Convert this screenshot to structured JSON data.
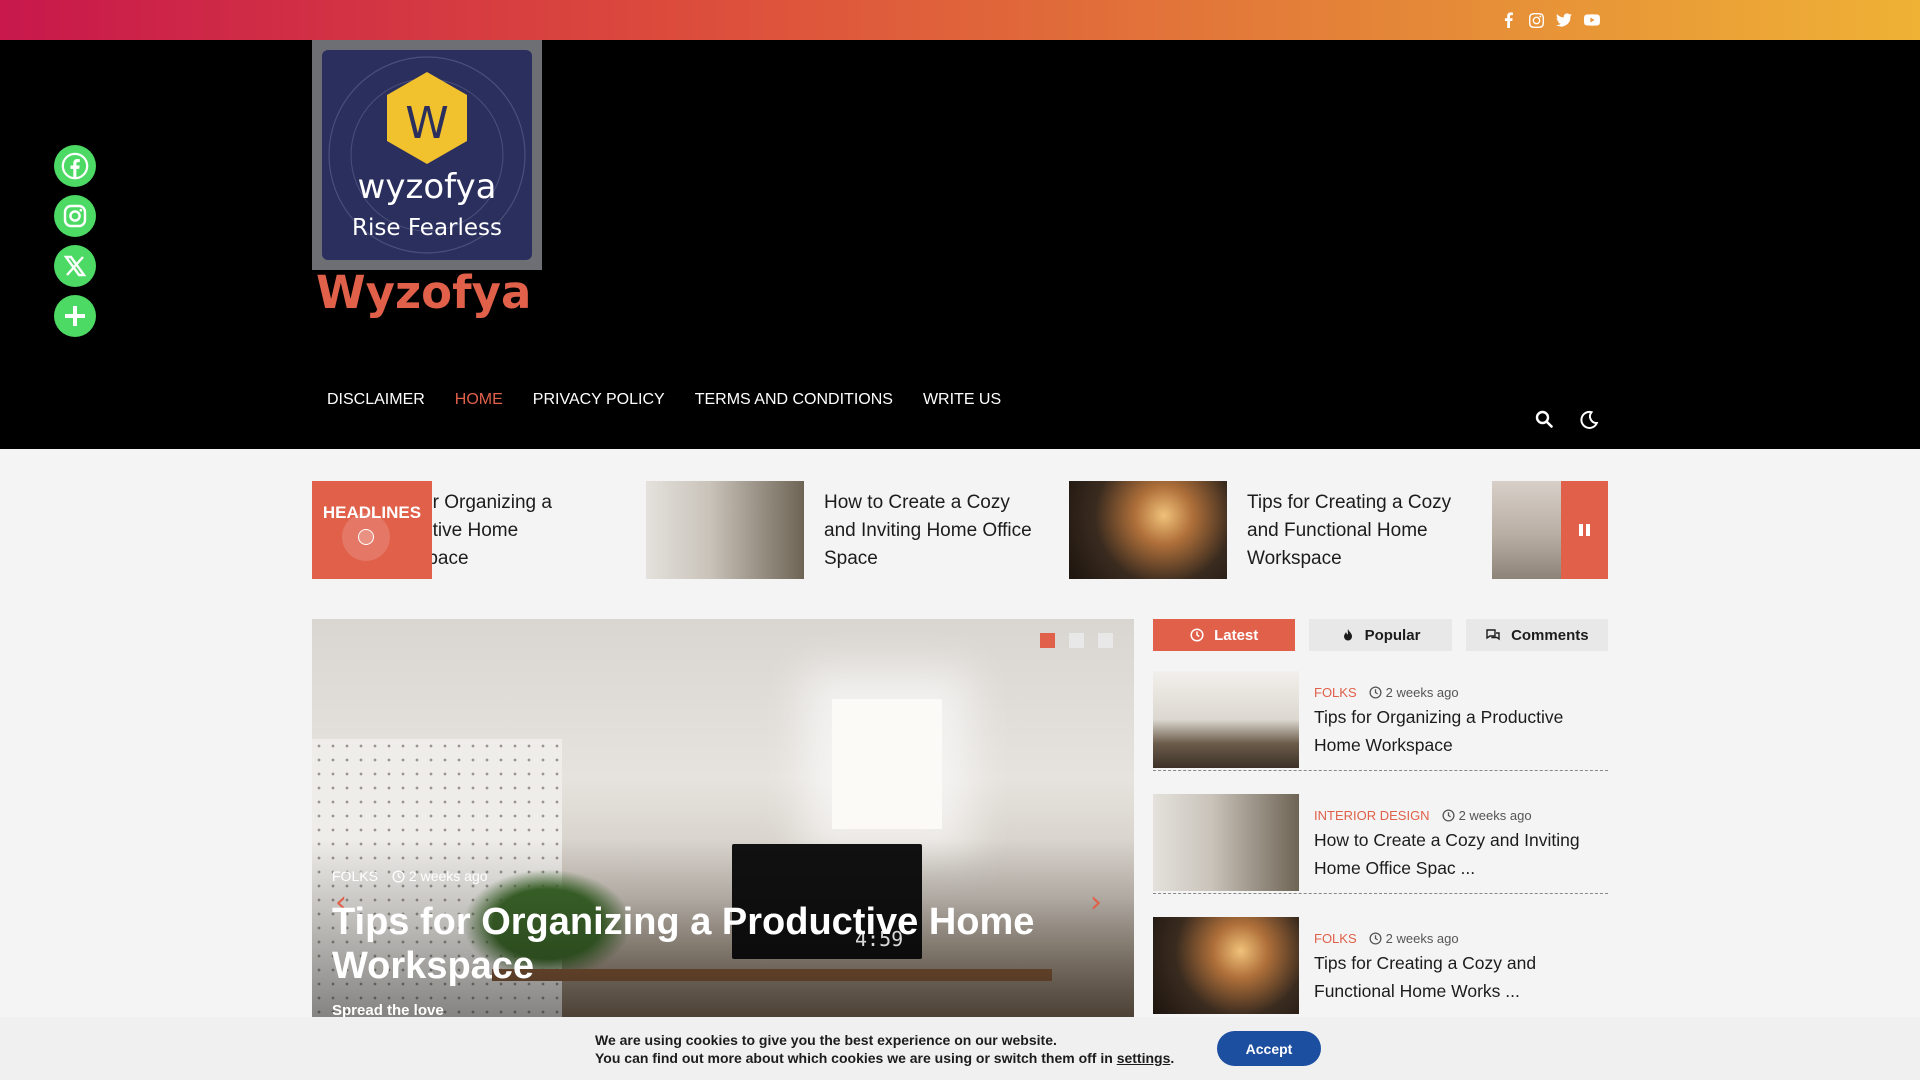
{
  "topbar": {
    "social": [
      "facebook-icon",
      "instagram-icon",
      "twitter-icon",
      "youtube-icon"
    ]
  },
  "logo": {
    "brand": "wyzofya",
    "tagline": "Rise Fearless",
    "letter": "W"
  },
  "site_title": "Wyzofya",
  "nav": {
    "items": [
      {
        "label": "DISCLAIMER",
        "active": false
      },
      {
        "label": "HOME",
        "active": true
      },
      {
        "label": "PRIVACY POLICY",
        "active": false
      },
      {
        "label": "TERMS AND CONDITIONS",
        "active": false
      },
      {
        "label": "WRITE US",
        "active": false
      }
    ]
  },
  "ticker": {
    "label": "HEADLINES",
    "items": [
      {
        "title": "s for Organizing a\nductive Home\nrkspace"
      },
      {
        "title": "How to Create a Cozy and Inviting Home Office Space"
      },
      {
        "title": "Tips for Creating a Cozy and Functional Home Workspace"
      }
    ]
  },
  "slider": {
    "category": "FOLKS",
    "time": "2 weeks ago",
    "title": "Tips for Organizing a Productive Home Workspace",
    "excerpt": "Spread the love",
    "clock": "4:59"
  },
  "tabs": [
    {
      "label": "Latest",
      "active": true
    },
    {
      "label": "Popular",
      "active": false
    },
    {
      "label": "Comments",
      "active": false
    }
  ],
  "posts": [
    {
      "category": "FOLKS",
      "time": "2 weeks ago",
      "title": "Tips for Organizing a Productive Home Workspace"
    },
    {
      "category": "INTERIOR DESIGN",
      "time": "2 weeks ago",
      "title": "How to Create a Cozy and Inviting Home Office Spac ..."
    },
    {
      "category": "FOLKS",
      "time": "2 weeks ago",
      "title": "Tips for Creating a Cozy and Functional Home Works ..."
    }
  ],
  "cookie": {
    "line1": "We are using cookies to give you the best experience on our website.",
    "line2": "You can find out more about which cookies we are using or switch them off in",
    "link": "settings",
    "accept": "Accept"
  },
  "colors": {
    "accent": "#e0604a",
    "share_green": "#4cd964",
    "accept_blue": "#1d4fa0"
  }
}
